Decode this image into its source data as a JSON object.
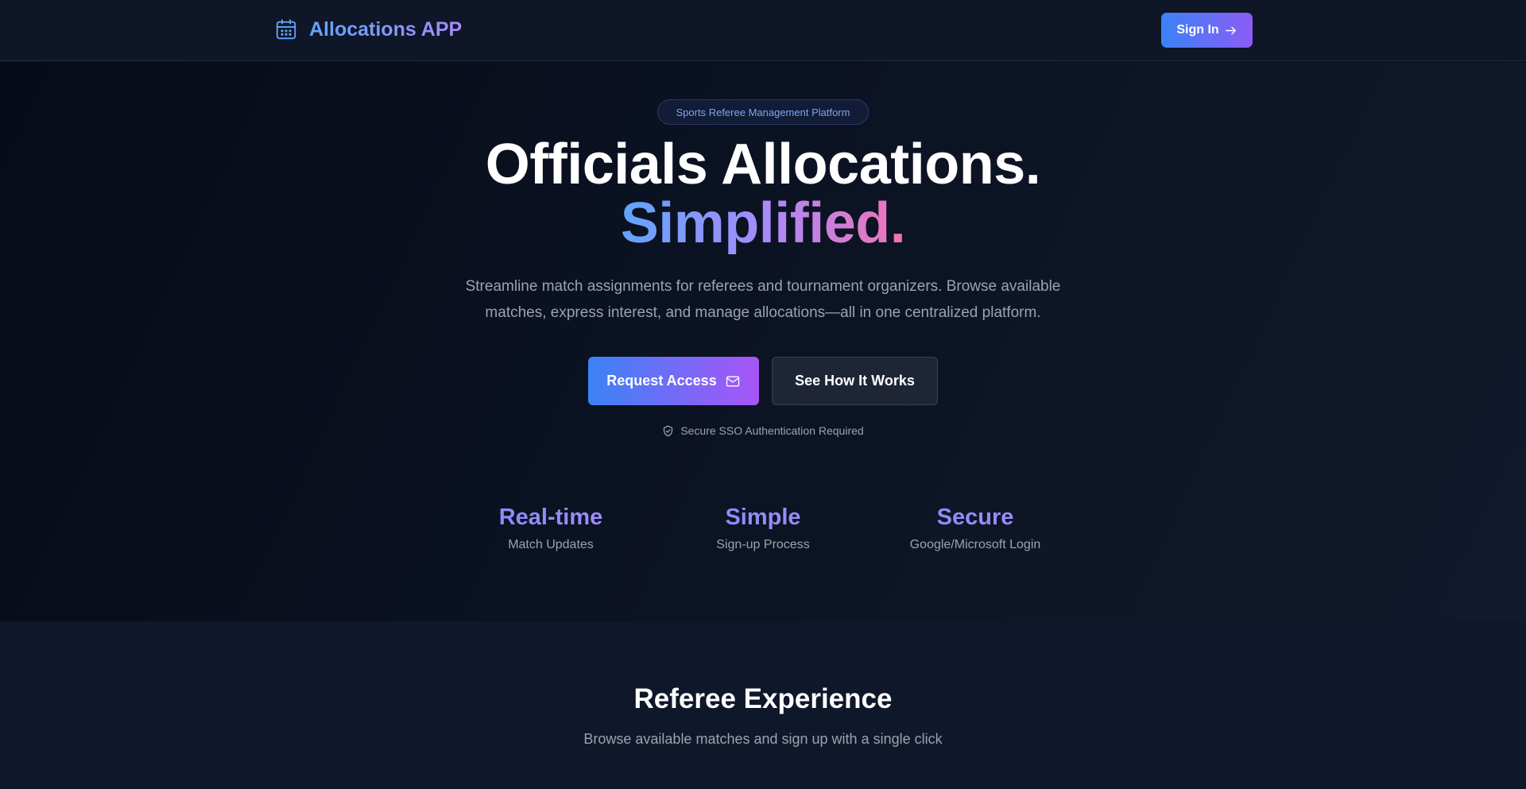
{
  "nav": {
    "brand": "Allocations APP",
    "brand_icon": "calendar-icon",
    "signin_label": "Sign In",
    "signin_icon": "arrow-right-icon"
  },
  "hero": {
    "badge": "Sports Referee Management Platform",
    "headline": "Officials Allocations.",
    "headline_accent": "Simplified.",
    "subtitle": "Streamline match assignments for referees and tournament organizers. Browse available matches, express interest, and manage allocations—all in one centralized platform.",
    "cta_primary": "Request Access",
    "cta_primary_icon": "mail-icon",
    "cta_secondary": "See How It Works",
    "sso_note": "Secure SSO Authentication Required",
    "sso_icon": "shield-check-icon"
  },
  "features": [
    {
      "title": "Real-time",
      "subtitle": "Match Updates"
    },
    {
      "title": "Simple",
      "subtitle": "Sign-up Process"
    },
    {
      "title": "Secure",
      "subtitle": "Google/Microsoft Login"
    }
  ],
  "referee_section": {
    "title": "Referee Experience",
    "subtitle": "Browse available matches and sign up with a single click"
  },
  "colors": {
    "accent_blue": "#3b82f6",
    "accent_purple": "#a855f7",
    "accent_pink": "#f472b6",
    "background": "#0b1120"
  }
}
